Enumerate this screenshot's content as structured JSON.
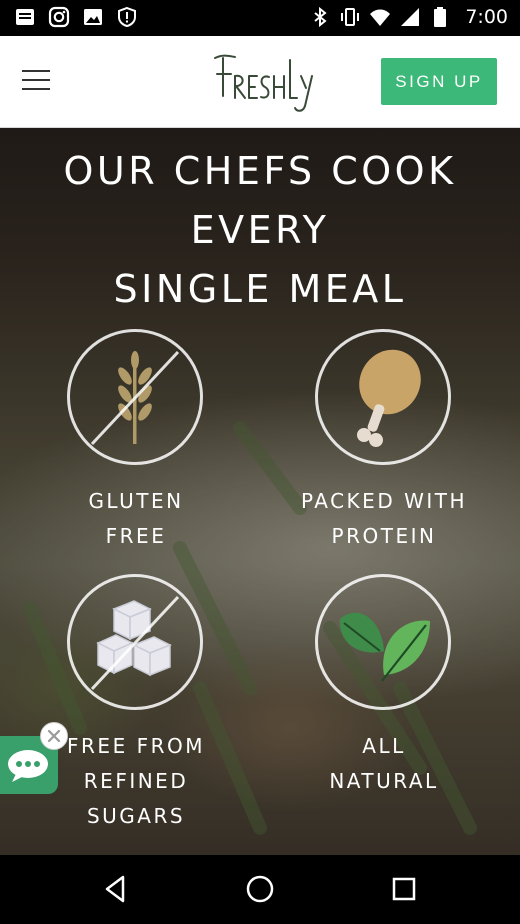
{
  "status_bar": {
    "time": "7:00",
    "left_icons": [
      "message-icon",
      "instagram-icon",
      "image-icon",
      "shield-icon"
    ],
    "right_icons": [
      "bluetooth-icon",
      "vibrate-icon",
      "wifi-icon",
      "signal-icon",
      "battery-icon"
    ]
  },
  "header": {
    "logo_text": "FRESHLY",
    "menu_icon": "hamburger-menu-icon",
    "signup_label": "SIGN UP",
    "accent_color": "#3cb878"
  },
  "hero": {
    "title_line1": "OUR CHEFS COOK EVERY",
    "title_line2": "SINGLE MEAL",
    "features": [
      {
        "line1": "GLUTEN",
        "line2": "FREE",
        "icon": "wheat-crossed-icon"
      },
      {
        "line1": "PACKED WITH",
        "line2": "PROTEIN",
        "icon": "chicken-leg-icon"
      },
      {
        "line1": "FREE FROM",
        "line2": "REFINED SUGARS",
        "icon": "sugar-cubes-crossed-icon"
      },
      {
        "line1": "ALL",
        "line2": "NATURAL",
        "icon": "leaves-icon"
      }
    ]
  },
  "chat_widget": {
    "icon": "chat-bubble-icon",
    "close_icon": "close-icon",
    "color": "#3aa06b"
  },
  "nav_bar": {
    "buttons": [
      "back-icon",
      "home-icon",
      "recents-icon"
    ]
  }
}
